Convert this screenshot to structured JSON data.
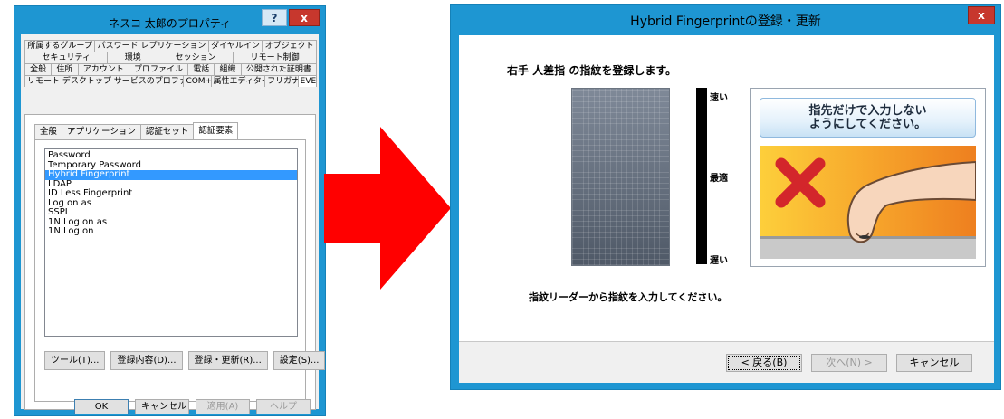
{
  "left_dialog": {
    "title": "ネスコ 太郎のプロパティ",
    "help_button": "?",
    "close_button": "x",
    "tab_rows": [
      [
        "所属するグループ",
        "パスワード レプリケーション",
        "ダイヤルイン",
        "オブジェクト"
      ],
      [
        "セキュリティ",
        "環境",
        "セッション",
        "リモート制御"
      ],
      [
        "全般",
        "住所",
        "アカウント",
        "プロファイル",
        "電話",
        "組織",
        "公開された証明書"
      ],
      [
        "リモート デスクトップ サービスのプロファイル",
        "COM+",
        "属性エディター",
        "フリガナ",
        "EVE"
      ]
    ],
    "active_tab": "EVE",
    "subtabs": [
      "全般",
      "アプリケーション",
      "認証セット",
      "認証要素"
    ],
    "active_subtab": "認証要素",
    "auth_items": [
      "Password",
      "Temporary Password",
      "Hybrid Fingerprint",
      "LDAP",
      "ID Less Fingerprint",
      "Log on as",
      "SSPI",
      "1N Log on as",
      "1N Log on"
    ],
    "selected_item": "Hybrid Fingerprint",
    "buttons": {
      "tool": "ツール(T)...",
      "details": "登録内容(D)...",
      "register": "登録・更新(R)...",
      "settings": "設定(S)..."
    },
    "footer_buttons": {
      "ok": "OK",
      "cancel": "キャンセル",
      "apply": "適用(A)",
      "help": "ヘルプ"
    }
  },
  "wizard": {
    "title": "Hybrid Fingerprintの登録・更新",
    "close_button": "x",
    "instruction_top": "右手 人差指 の指紋を登録します。",
    "meter": {
      "top": "速い",
      "middle": "最適",
      "bottom": "遅い"
    },
    "guide_text_line1": "指先だけで入力しない",
    "guide_text_line2": "ようにしてください。",
    "instruction_bottom": "指紋リーダーから指紋を入力してください。",
    "buttons": {
      "back": "< 戻る(B)",
      "next": "次へ(N) >",
      "cancel": "キャンセル"
    }
  },
  "colors": {
    "title_bar": "#1e96d2",
    "selection": "#3399ff",
    "close_red": "#c7372d",
    "arrow": "#ff0000"
  },
  "icons": {
    "arrow": "right-arrow-icon",
    "wrong": "x-mark-icon",
    "finger": "finger-icon"
  }
}
